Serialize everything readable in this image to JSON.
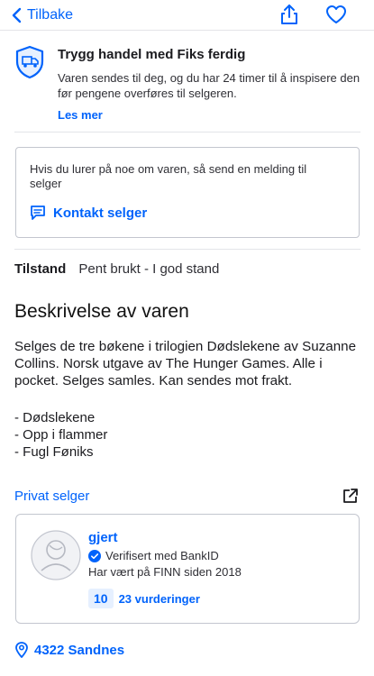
{
  "nav": {
    "back_label": "Tilbake",
    "icons": [
      "chevron-left-icon",
      "share-icon",
      "heart-icon"
    ]
  },
  "trust": {
    "title": "Trygg handel med Fiks ferdig",
    "text": "Varen sendes til deg, og du har 24 timer til å inspisere den før pengene overføres til selgeren.",
    "link": "Les mer",
    "icon": "shield-truck-icon"
  },
  "contact": {
    "text": "Hvis du lurer på noe om varen, så send en melding til selger",
    "button_label": "Kontakt selger",
    "icon": "message-icon"
  },
  "condition": {
    "label": "Tilstand",
    "value": "Pent brukt - I god stand"
  },
  "description": {
    "title": "Beskrivelse av varen",
    "body": "Selges de tre bøkene i trilogien Dødslekene av Suzanne Collins. Norsk utgave av The Hunger Games. Alle i pocket. Selges samles. Kan sendes mot frakt.",
    "list": [
      "- Dødslekene",
      "- Opp i flammer",
      "- Fugl Føniks"
    ]
  },
  "seller": {
    "type_label": "Privat selger",
    "name": "gjert",
    "verified": "Verifisert med BankID",
    "member_since": "Har vært på FINN siden 2018",
    "score": "10",
    "reviews": "23 vurderinger",
    "icons": [
      "external-link-icon",
      "avatar-icon",
      "verified-badge-icon"
    ]
  },
  "location": {
    "text": "4322 Sandnes",
    "icon": "location-pin-icon"
  },
  "colors": {
    "accent": "#0063fb",
    "text": "#1b1b1f",
    "border": "#c3c6cf",
    "score_bg": "#e6f0ff"
  }
}
